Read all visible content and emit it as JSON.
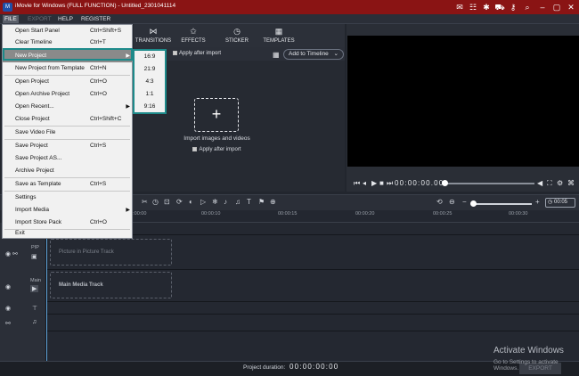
{
  "titlebar": {
    "title": "iMovie for Windows (FULL FUNCTION) - Untitled_2301041114",
    "icon": "app-logo",
    "controls": [
      "pin-icon",
      "chat-icon",
      "gift-icon",
      "key-icon",
      "search-icon",
      "minimize-icon",
      "maximize-icon",
      "close-icon"
    ]
  },
  "menubar": {
    "items": [
      {
        "label": "FILE",
        "active": true
      },
      {
        "label": "EXPORT",
        "active": false
      },
      {
        "label": "HELP",
        "active": false
      },
      {
        "label": "REGISTER",
        "active": false
      }
    ],
    "right_icons": [
      "display-icon",
      "bug-icon",
      "cart-icon",
      "key-icon",
      "search-icon"
    ]
  },
  "tabs": [
    {
      "label": "TRANSITIONS",
      "icon": "bowtie-icon"
    },
    {
      "label": "EFFECTS",
      "icon": "sparkle-icon"
    },
    {
      "label": "STICKER",
      "icon": "clock-icon"
    },
    {
      "label": "TEMPLATES",
      "icon": "film-icon"
    }
  ],
  "media": {
    "apply_after_import": "Apply after import",
    "add_to_timeline": "Add to Timeline",
    "import_label": "Import images and videos",
    "import_checkbox": "Apply after import"
  },
  "preview": {
    "timecode": "00:00:00.00",
    "progress": 0
  },
  "timeline": {
    "zoom_value": "00:05",
    "ruler": [
      "00:00:00",
      "00:00:10",
      "00:00:15",
      "00:00:20",
      "00:00:25",
      "00:00:30"
    ],
    "tracks": [
      {
        "label": "PIP",
        "placeholder": "Picture in Picture Track"
      },
      {
        "label": "Main",
        "placeholder": "Main Media Track"
      }
    ]
  },
  "status": {
    "duration_label": "Project duration:",
    "duration_value": "00:00:00:00",
    "export": "EXPORT"
  },
  "watermark": {
    "line1": "Activate Windows",
    "line2": "Go to Settings to activate Windows."
  },
  "file_menu": {
    "items": [
      {
        "label": "Open Start Panel",
        "shortcut": "Ctrl+Shift+S"
      },
      {
        "label": "Clear Timeline",
        "shortcut": "Ctrl+T"
      },
      {
        "label": "New Project",
        "shortcut": "",
        "submenu": true,
        "highlighted": true
      },
      {
        "label": "New Project from Template",
        "shortcut": "Ctrl+N"
      },
      {
        "label": "Open Project",
        "shortcut": "Ctrl+O"
      },
      {
        "label": "Open Archive Project",
        "shortcut": "Ctrl+O"
      },
      {
        "label": "Open Recent...",
        "shortcut": "",
        "submenu": true
      },
      {
        "label": "Close Project",
        "shortcut": "Ctrl+Shift+C"
      },
      {
        "label": "Save Video File",
        "shortcut": ""
      },
      {
        "label": "Save Project",
        "shortcut": "Ctrl+S"
      },
      {
        "label": "Save Project AS...",
        "shortcut": ""
      },
      {
        "label": "Archive Project",
        "shortcut": ""
      },
      {
        "label": "Save as Template",
        "shortcut": "Ctrl+S"
      },
      {
        "label": "Settings",
        "shortcut": ""
      },
      {
        "label": "Import Media",
        "shortcut": "",
        "submenu": true
      },
      {
        "label": "Import Store Pack",
        "shortcut": "Ctrl+O"
      },
      {
        "label": "Exit",
        "shortcut": ""
      }
    ]
  },
  "submenu": {
    "items": [
      "16:9",
      "21:9",
      "4:3",
      "1:1",
      "9:16"
    ]
  },
  "colors": {
    "titlebar": "#8a1414",
    "accent": "#1d8a8a",
    "playhead": "#5fa3d8"
  }
}
